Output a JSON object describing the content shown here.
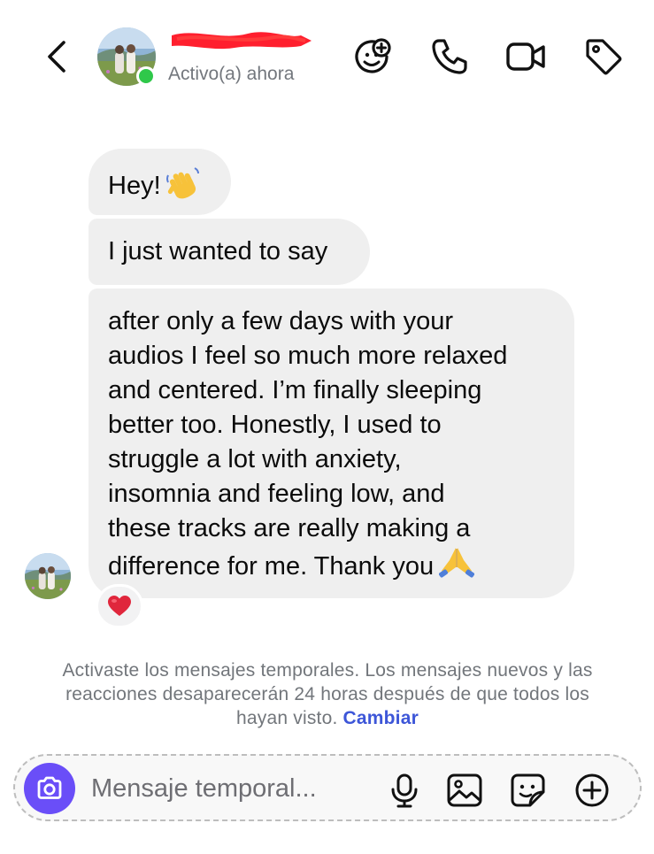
{
  "header": {
    "status": "Activo(a) ahora",
    "online_color": "#2fc84a",
    "icons": [
      "back-chevron-icon",
      "add-effects-icon",
      "phone-icon",
      "video-camera-icon",
      "tag-icon"
    ]
  },
  "messages": [
    {
      "text": "Hey!",
      "emoji": "waving-hand"
    },
    {
      "text": "I just wanted to say"
    },
    {
      "text": "after only a few days with your\naudios I feel so much more relaxed\nand centered. I’m finally sleeping\nbetter too. Honestly, I used to\nstruggle a lot with anxiety,\ninsomnia and feeling low, and\nthese tracks are really making a\ndifference for me. Thank you",
      "emoji": "folded-hands"
    }
  ],
  "reaction": {
    "emoji": "heart",
    "color": "#e0263c"
  },
  "notice": {
    "text": "Activaste los mensajes temporales. Los mensajes nuevos y las reacciones desaparecerán 24 horas después de que todos los hayan visto.",
    "link": "Cambiar",
    "link_color": "#3d56d8"
  },
  "composer": {
    "placeholder": "Mensaje temporal...",
    "camera_color": "#6a4ef8",
    "icons": [
      "microphone-icon",
      "gallery-icon",
      "sticker-icon",
      "add-icon"
    ]
  }
}
